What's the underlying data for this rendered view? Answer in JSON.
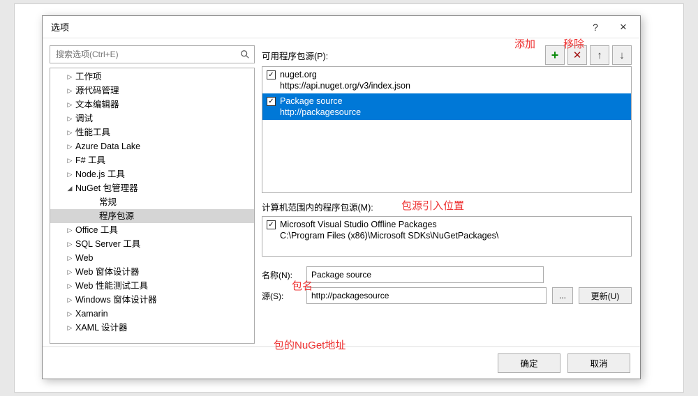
{
  "dialog": {
    "title": "选项",
    "help": "?",
    "close": "×"
  },
  "search": {
    "placeholder": "搜索选项(Ctrl+E)"
  },
  "tree": {
    "items": [
      {
        "label": "工作项",
        "level": 1,
        "arrow": "▷"
      },
      {
        "label": "源代码管理",
        "level": 1,
        "arrow": "▷"
      },
      {
        "label": "文本编辑器",
        "level": 1,
        "arrow": "▷"
      },
      {
        "label": "调试",
        "level": 1,
        "arrow": "▷"
      },
      {
        "label": "性能工具",
        "level": 1,
        "arrow": "▷"
      },
      {
        "label": "Azure Data Lake",
        "level": 1,
        "arrow": "▷"
      },
      {
        "label": "F# 工具",
        "level": 1,
        "arrow": "▷"
      },
      {
        "label": "Node.js 工具",
        "level": 1,
        "arrow": "▷"
      },
      {
        "label": "NuGet 包管理器",
        "level": 1,
        "arrow": "◢"
      },
      {
        "label": "常规",
        "level": 2,
        "arrow": ""
      },
      {
        "label": "程序包源",
        "level": 2,
        "arrow": "",
        "selected": true
      },
      {
        "label": "Office 工具",
        "level": 1,
        "arrow": "▷"
      },
      {
        "label": "SQL Server 工具",
        "level": 1,
        "arrow": "▷"
      },
      {
        "label": "Web",
        "level": 1,
        "arrow": "▷"
      },
      {
        "label": "Web 窗体设计器",
        "level": 1,
        "arrow": "▷"
      },
      {
        "label": "Web 性能测试工具",
        "level": 1,
        "arrow": "▷"
      },
      {
        "label": "Windows 窗体设计器",
        "level": 1,
        "arrow": "▷"
      },
      {
        "label": "Xamarin",
        "level": 1,
        "arrow": "▷"
      },
      {
        "label": "XAML 设计器",
        "level": 1,
        "arrow": "▷"
      }
    ]
  },
  "right": {
    "available_label": "可用程序包源(P):",
    "machine_label": "计算机范围内的程序包源(M):",
    "name_label": "名称(N):",
    "source_label": "源(S):",
    "browse_label": "...",
    "update_label": "更新(U)",
    "name_value": "Package source",
    "source_value": "http://packagesource"
  },
  "sources": [
    {
      "checked": true,
      "name": "nuget.org",
      "url": "https://api.nuget.org/v3/index.json",
      "selected": false
    },
    {
      "checked": true,
      "name": "Package source",
      "url": "http://packagesource",
      "selected": true
    }
  ],
  "machine_sources": [
    {
      "checked": true,
      "name": "Microsoft Visual Studio Offline Packages",
      "url": "C:\\Program Files (x86)\\Microsoft SDKs\\NuGetPackages\\"
    }
  ],
  "buttons": {
    "ok": "确定",
    "cancel": "取消"
  },
  "annotations": {
    "add": "添加",
    "remove": "移除",
    "source_position": "包源引入位置",
    "package_name": "包名",
    "nuget_addr": "包的NuGet地址"
  },
  "icons": {
    "plus": "+",
    "cross": "✕",
    "up": "↑",
    "down": "↓",
    "check": "✓"
  }
}
